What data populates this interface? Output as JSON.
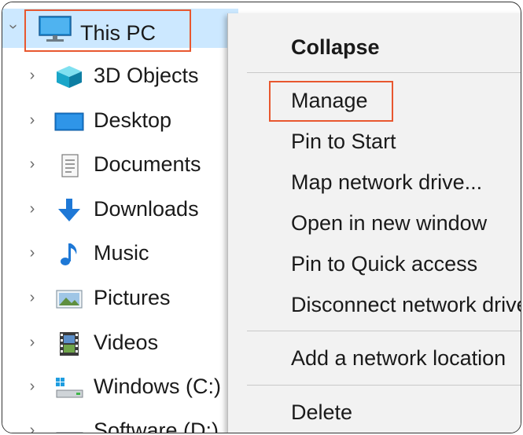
{
  "tree": {
    "root_label": "This PC",
    "items": [
      {
        "label": "3D Objects",
        "icon": "3d-objects-icon"
      },
      {
        "label": "Desktop",
        "icon": "desktop-icon"
      },
      {
        "label": "Documents",
        "icon": "documents-icon"
      },
      {
        "label": "Downloads",
        "icon": "downloads-icon"
      },
      {
        "label": "Music",
        "icon": "music-icon"
      },
      {
        "label": "Pictures",
        "icon": "pictures-icon"
      },
      {
        "label": "Videos",
        "icon": "videos-icon"
      },
      {
        "label": "Windows (C:)",
        "icon": "drive-c-icon"
      },
      {
        "label": "Software (D:)",
        "icon": "drive-d-icon"
      }
    ]
  },
  "menu": {
    "collapse": "Collapse",
    "manage": "Manage",
    "pin_start": "Pin to Start",
    "map_drive": "Map network drive...",
    "open_new_window": "Open in new window",
    "pin_quick": "Pin to Quick access",
    "disconnect": "Disconnect network drive...",
    "add_location": "Add a network location",
    "delete": "Delete"
  },
  "colors": {
    "selection": "#cce8ff",
    "highlight": "#e8572f",
    "menu_bg": "#f2f2f2"
  }
}
